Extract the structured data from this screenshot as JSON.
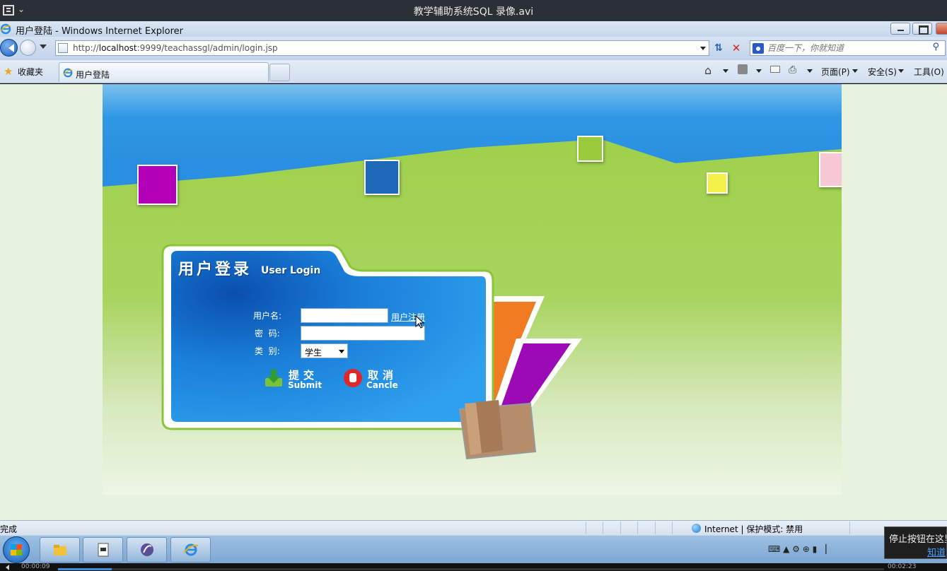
{
  "player": {
    "title": "教学辅助系统SQL 录像.avi",
    "time_current": "00:00:09",
    "time_total": "00:02:23",
    "progress": 0.065
  },
  "window": {
    "title": "用户登陆 - Windows Internet Explorer"
  },
  "address_bar": {
    "url_prefix": "http://",
    "url_host": "localhost",
    "url_rest": ":9999/teachassgl/admin/login.jsp"
  },
  "search": {
    "placeholder": "百度一下，你就知道"
  },
  "favorites": {
    "label": "收藏夹"
  },
  "tabs": [
    {
      "label": "用户登陆"
    }
  ],
  "command_bar": {
    "page": "页面(P)",
    "safety": "安全(S)",
    "tools": "工具(O)"
  },
  "login": {
    "title_cn": "用户登录",
    "title_en": "User Login",
    "username_label": "用户名:",
    "password_label": "密  码:",
    "type_label": "类  别:",
    "register_link": "用户注册",
    "type_value": "学生",
    "submit_cn": "提交",
    "submit_en": "Submit",
    "cancel_cn": "取消",
    "cancel_en": "Cancle"
  },
  "status_bar": {
    "text": "完成",
    "zone": "Internet | 保护模式: 禁用"
  },
  "tooltip": {
    "text": "停止按钮在这里",
    "link": "知道"
  },
  "colors": {
    "sky": "#2a8fe0",
    "grass": "#9fd14b",
    "card_blue": "#1a7fd8",
    "square_magenta": "#b400b8",
    "square_blue": "#1f6ab8",
    "square_green": "#9acb3c",
    "square_yellow": "#f4f24a",
    "square_pink": "#f6c8d3",
    "folder_orange": "#f07b22",
    "folder_purple": "#9b0ab5"
  }
}
